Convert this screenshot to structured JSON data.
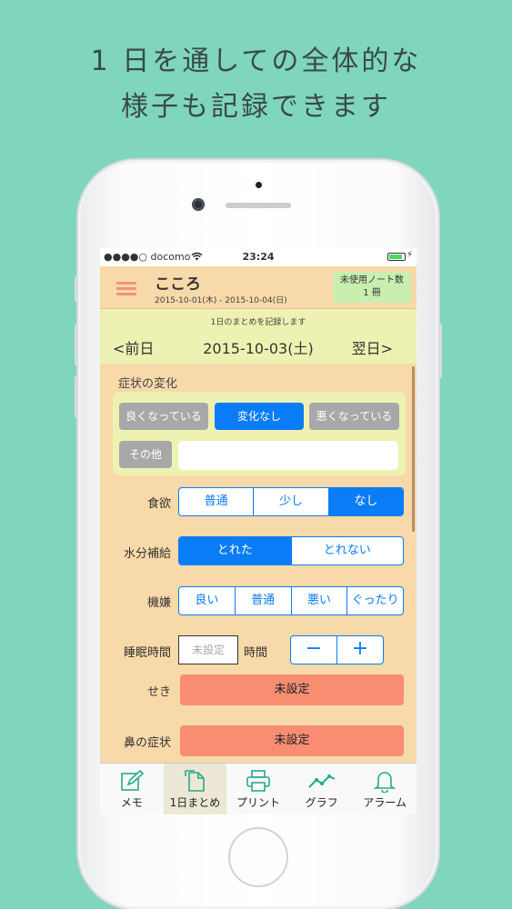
{
  "headline": {
    "line1": "1 日を通しての全体的な",
    "line2": "様子も記録できます"
  },
  "status": {
    "carrier": "●●●●○ docomo",
    "time": "23:24"
  },
  "nav": {
    "title": "こころ",
    "range": "2015-10-01(木) - 2015-10-04(日)",
    "notebook_line1": "未使用ノート数",
    "notebook_line2": "1 冊"
  },
  "day": {
    "caption": "1日のまとめを記録します",
    "prev": "<前日",
    "date": "2015-10-03(土)",
    "next": "翌日>"
  },
  "symptom": {
    "label": "症状の変化",
    "better": "良くなっている",
    "no_change": "変化なし",
    "worse": "悪くなっている",
    "other": "その他",
    "other_value": ""
  },
  "appetite": {
    "label": "食欲",
    "options": [
      "普通",
      "少し",
      "なし"
    ],
    "selected": "なし"
  },
  "hydration": {
    "label": "水分補給",
    "options": [
      "とれた",
      "とれない"
    ],
    "selected": "とれた"
  },
  "mood": {
    "label": "機嫌",
    "options": [
      "良い",
      "普通",
      "悪い",
      "ぐったり"
    ]
  },
  "sleep": {
    "label": "睡眠時間",
    "placeholder": "未設定",
    "unit": "時間",
    "minus": "−",
    "plus": "+"
  },
  "cough": {
    "label": "せき",
    "value": "未設定"
  },
  "nose": {
    "label": "鼻の症状",
    "value": "未設定"
  },
  "tabs": [
    {
      "label": "メモ",
      "icon": "pencil-icon"
    },
    {
      "label": "1日まとめ",
      "icon": "document-icon",
      "active": true
    },
    {
      "label": "プリント",
      "icon": "printer-icon"
    },
    {
      "label": "グラフ",
      "icon": "graph-icon"
    },
    {
      "label": "アラーム",
      "icon": "bell-icon"
    }
  ],
  "colors": {
    "background": "#7fd6bd",
    "screen": "#f8d9a9",
    "accent_blue": "#0a7cf6",
    "salmon": "#f98d72",
    "tab_icon": "#27a98c"
  }
}
